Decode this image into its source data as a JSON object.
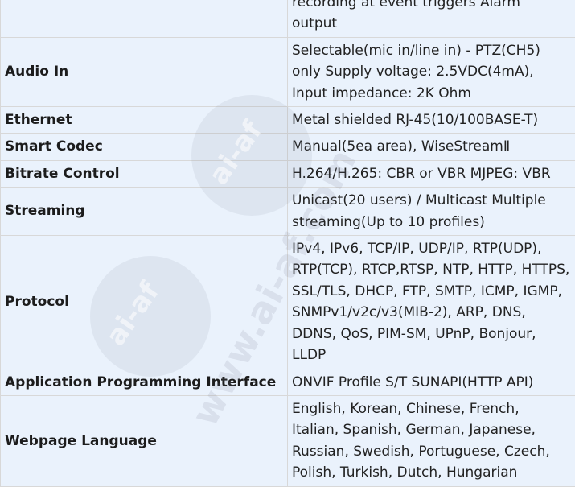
{
  "rows": [
    {
      "label": "",
      "value": "recording at event triggers Alarm\noutput"
    },
    {
      "label": "Audio In",
      "value": "Selectable(mic in/line in) - PTZ(CH5)\nonly Supply voltage: 2.5VDC(4mA),\nInput impedance: 2K Ohm"
    },
    {
      "label": "Ethernet",
      "value": "Metal shielded RJ-45(10/100BASE-T)"
    },
    {
      "label": "Smart Codec",
      "value": "Manual(5ea area), WiseStreamⅡ"
    },
    {
      "label": "Bitrate Control",
      "value": "H.264/H.265: CBR or VBR MJPEG: VBR"
    },
    {
      "label": "Streaming",
      "value": "Unicast(20 users) / Multicast Multiple\nstreaming(Up to 10 profiles)"
    },
    {
      "label": "Protocol",
      "value": "IPv4, IPv6, TCP/IP, UDP/IP, RTP(UDP),\nRTP(TCP), RTCP,RTSP, NTP, HTTP, HTTPS,\nSSL/TLS, DHCP, FTP, SMTP, ICMP, IGMP,\nSNMPv1/v2c/v3(MIB-2), ARP, DNS,\nDDNS, QoS, PIM-SM, UPnP, Bonjour,\nLLDP"
    },
    {
      "label": "Application Programming Interface",
      "value": "ONVIF Profile S/T SUNAPI(HTTP API)"
    },
    {
      "label": "Webpage Language",
      "value": "English, Korean, Chinese, French,\nItalian, Spanish, German, Japanese,\nRussian, Swedish, Portuguese, Czech,\nPolish, Turkish, Dutch, Hungarian"
    }
  ],
  "watermark": {
    "text_a": "ai-af",
    "text_b": "www.ai-af.com"
  }
}
